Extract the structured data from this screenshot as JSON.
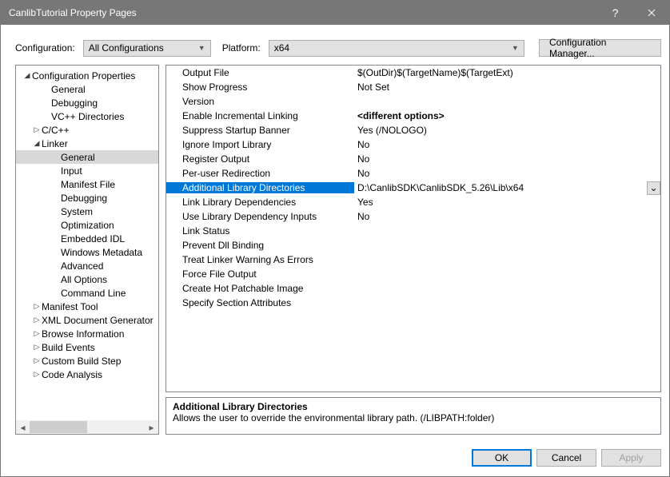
{
  "title": "CanlibTutorial Property Pages",
  "toprow": {
    "config_label": "Configuration:",
    "config_value": "All Configurations",
    "platform_label": "Platform:",
    "platform_value": "x64",
    "configmgr": "Configuration Manager..."
  },
  "tree": {
    "root": "Configuration Properties",
    "items": [
      {
        "label": "General",
        "indent": 44
      },
      {
        "label": "Debugging",
        "indent": 44
      },
      {
        "label": "VC++ Directories",
        "indent": 44
      },
      {
        "label": "C/C++",
        "indent": 32,
        "arrow": "▷"
      },
      {
        "label": "Linker",
        "indent": 32,
        "arrow": "◢"
      },
      {
        "label": "General",
        "indent": 56,
        "selected": true
      },
      {
        "label": "Input",
        "indent": 56
      },
      {
        "label": "Manifest File",
        "indent": 56
      },
      {
        "label": "Debugging",
        "indent": 56
      },
      {
        "label": "System",
        "indent": 56
      },
      {
        "label": "Optimization",
        "indent": 56
      },
      {
        "label": "Embedded IDL",
        "indent": 56
      },
      {
        "label": "Windows Metadata",
        "indent": 56
      },
      {
        "label": "Advanced",
        "indent": 56
      },
      {
        "label": "All Options",
        "indent": 56
      },
      {
        "label": "Command Line",
        "indent": 56
      },
      {
        "label": "Manifest Tool",
        "indent": 32,
        "arrow": "▷"
      },
      {
        "label": "XML Document Generator",
        "indent": 32,
        "arrow": "▷"
      },
      {
        "label": "Browse Information",
        "indent": 32,
        "arrow": "▷"
      },
      {
        "label": "Build Events",
        "indent": 32,
        "arrow": "▷"
      },
      {
        "label": "Custom Build Step",
        "indent": 32,
        "arrow": "▷"
      },
      {
        "label": "Code Analysis",
        "indent": 32,
        "arrow": "▷"
      }
    ]
  },
  "grid": [
    {
      "name": "Output File",
      "value": "$(OutDir)$(TargetName)$(TargetExt)"
    },
    {
      "name": "Show Progress",
      "value": "Not Set"
    },
    {
      "name": "Version",
      "value": ""
    },
    {
      "name": "Enable Incremental Linking",
      "value": "<different options>",
      "bold": true
    },
    {
      "name": "Suppress Startup Banner",
      "value": "Yes (/NOLOGO)"
    },
    {
      "name": "Ignore Import Library",
      "value": "No"
    },
    {
      "name": "Register Output",
      "value": "No"
    },
    {
      "name": "Per-user Redirection",
      "value": "No"
    },
    {
      "name": "Additional Library Directories",
      "value": "D:\\CanlibSDK\\CanlibSDK_5.26\\Lib\\x64",
      "selected": true,
      "drop": true
    },
    {
      "name": "Link Library Dependencies",
      "value": "Yes"
    },
    {
      "name": "Use Library Dependency Inputs",
      "value": "No"
    },
    {
      "name": "Link Status",
      "value": ""
    },
    {
      "name": "Prevent Dll Binding",
      "value": ""
    },
    {
      "name": "Treat Linker Warning As Errors",
      "value": ""
    },
    {
      "name": "Force File Output",
      "value": ""
    },
    {
      "name": "Create Hot Patchable Image",
      "value": ""
    },
    {
      "name": "Specify Section Attributes",
      "value": ""
    }
  ],
  "desc": {
    "title": "Additional Library Directories",
    "text": "Allows the user to override the environmental library path. (/LIBPATH:folder)"
  },
  "buttons": {
    "ok": "OK",
    "cancel": "Cancel",
    "apply": "Apply"
  }
}
